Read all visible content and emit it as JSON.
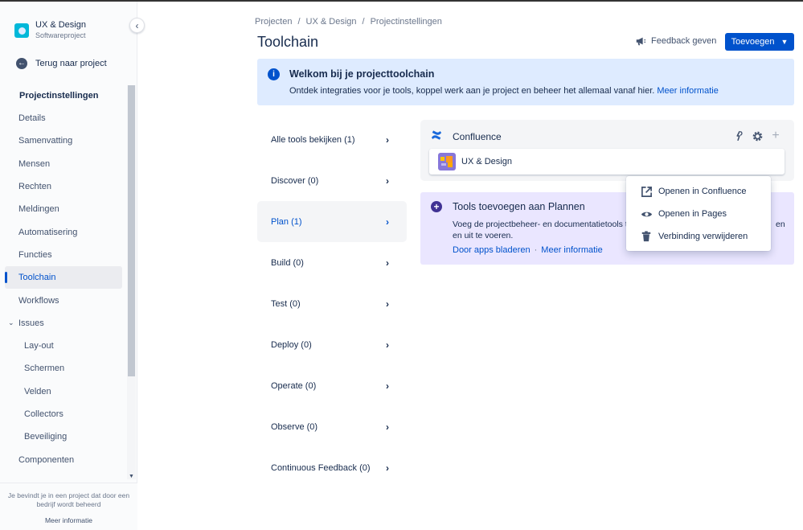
{
  "project": {
    "name": "UX & Design",
    "type": "Softwareproject"
  },
  "sidebar": {
    "back_label": "Terug naar project",
    "heading": "Projectinstellingen",
    "items": [
      {
        "label": "Details"
      },
      {
        "label": "Samenvatting"
      },
      {
        "label": "Mensen"
      },
      {
        "label": "Rechten"
      },
      {
        "label": "Meldingen"
      },
      {
        "label": "Automatisering"
      },
      {
        "label": "Functies"
      },
      {
        "label": "Toolchain"
      },
      {
        "label": "Workflows"
      },
      {
        "label": "Issues"
      },
      {
        "label": "Lay-out"
      },
      {
        "label": "Schermen"
      },
      {
        "label": "Velden"
      },
      {
        "label": "Collectors"
      },
      {
        "label": "Beveiliging"
      },
      {
        "label": "Componenten"
      }
    ],
    "footer_text": "Je bevindt je in een project dat door een bedrijf wordt beheerd",
    "footer_link": "Meer informatie"
  },
  "breadcrumb": [
    "Projecten",
    "/",
    "UX & Design",
    "/",
    "Projectinstellingen"
  ],
  "page_title": "Toolchain",
  "header": {
    "feedback_label": "Feedback geven",
    "add_label": "Toevoegen"
  },
  "banner": {
    "title": "Welkom bij je projecttoolchain",
    "text": "Ontdek integraties voor je tools, koppel werk aan je project en beheer het allemaal vanaf hier.",
    "link": "Meer informatie"
  },
  "stages": [
    {
      "label": "Alle tools bekijken (1)"
    },
    {
      "label": "Discover (0)"
    },
    {
      "label": "Plan (1)"
    },
    {
      "label": "Build (0)"
    },
    {
      "label": "Test (0)"
    },
    {
      "label": "Deploy (0)"
    },
    {
      "label": "Operate (0)"
    },
    {
      "label": "Observe (0)"
    },
    {
      "label": "Continuous Feedback (0)"
    }
  ],
  "confluence": {
    "title": "Confluence",
    "space_name": "UX & Design"
  },
  "plan_card": {
    "title": "Tools toevoegen aan Plannen",
    "text_line1": "Voeg de projectbeheer- en documentatietools to",
    "text_line1_tail": "en",
    "text_line2": "en uit te voeren.",
    "link1": "Door apps bladeren",
    "separator": "·",
    "link2": "Meer informatie"
  },
  "dropdown": {
    "items": [
      {
        "label": "Openen in Confluence",
        "icon": "external-link-icon"
      },
      {
        "label": "Openen in Pages",
        "icon": "eye-icon"
      },
      {
        "label": "Verbinding verwijderen",
        "icon": "trash-icon"
      }
    ]
  },
  "colors": {
    "primary": "#0052CC",
    "banner_bg": "#DEEBFF",
    "plan_bg": "#EAE6FF",
    "text": "#172B4D"
  }
}
